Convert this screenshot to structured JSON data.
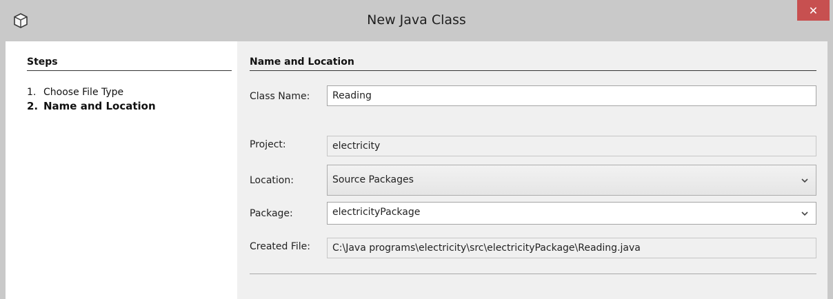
{
  "window": {
    "title": "New Java Class",
    "close_label": "✕",
    "app_icon": "netbeans-cube-icon"
  },
  "steps": {
    "title": "Steps",
    "items": [
      {
        "number": "1.",
        "label": "Choose File Type",
        "current": false
      },
      {
        "number": "2.",
        "label": "Name and Location",
        "current": true
      }
    ]
  },
  "form": {
    "section_title": "Name and Location",
    "class_name": {
      "label": "Class Name:",
      "value": "Reading"
    },
    "project": {
      "label": "Project:",
      "value": "electricity"
    },
    "location": {
      "label": "Location:",
      "value": "Source Packages"
    },
    "package": {
      "label": "Package:",
      "value": "electricityPackage"
    },
    "created_file": {
      "label": "Created File:",
      "value": "C:\\Java programs\\electricity\\src\\electricityPackage\\Reading.java"
    }
  },
  "colors": {
    "titlebar": "#c9c9c9",
    "close_button": "#c75050",
    "panel": "#f0f0f0",
    "steps_panel": "#ffffff"
  }
}
